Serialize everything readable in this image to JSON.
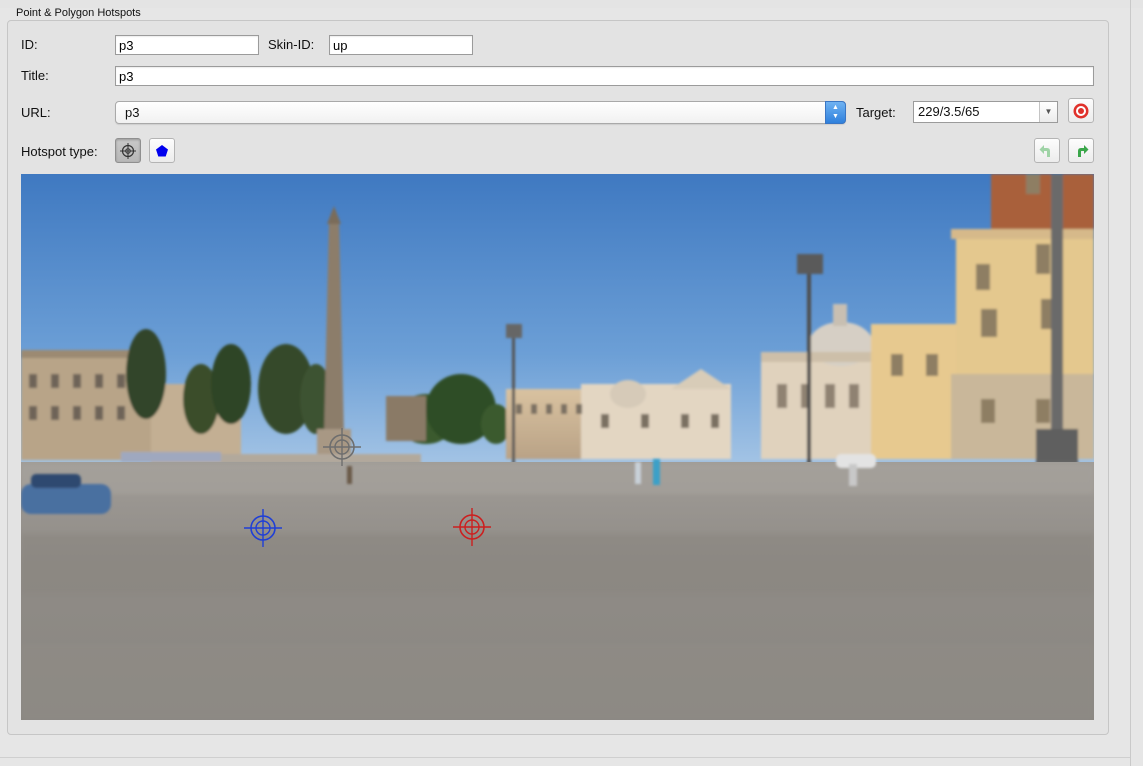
{
  "panel": {
    "title": "Point & Polygon Hotspots"
  },
  "form": {
    "id_label": "ID:",
    "id_value": "p3",
    "skin_id_label": "Skin-ID:",
    "skin_id_value": "up",
    "title_label": "Title:",
    "title_value": "p3",
    "url_label": "URL:",
    "url_value": "p3",
    "target_label": "Target:",
    "target_value": "229/3.5/65",
    "hotspot_type_label": "Hotspot type:"
  },
  "icons": {
    "pick_target": "target-icon",
    "point_type": "crosshair-icon",
    "polygon_type": "pentagon-icon",
    "undo": "undo-arrow-icon",
    "redo": "redo-arrow-icon"
  },
  "hotspots": [
    {
      "name": "hotspot-gray",
      "color": "#6e6e6e",
      "state": "inactive"
    },
    {
      "name": "hotspot-blue",
      "color": "#1f3fd6",
      "state": "other"
    },
    {
      "name": "hotspot-red",
      "color": "#cc1f1f",
      "state": "selected"
    }
  ],
  "colors": {
    "accent_blue": "#2f80dc",
    "polygon_blue": "#0000ee",
    "target_red": "#e0312b",
    "arrow_green": "#3aa64a"
  }
}
